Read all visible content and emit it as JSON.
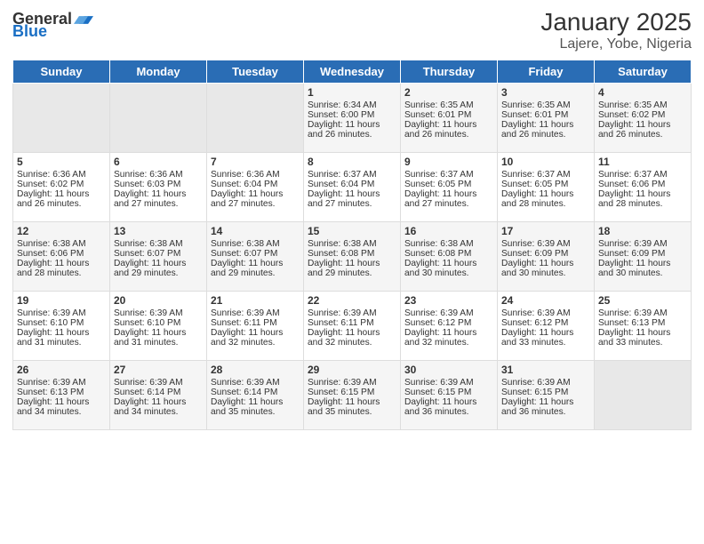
{
  "header": {
    "logo_general": "General",
    "logo_blue": "Blue",
    "title": "January 2025",
    "subtitle": "Lajere, Yobe, Nigeria"
  },
  "weekdays": [
    "Sunday",
    "Monday",
    "Tuesday",
    "Wednesday",
    "Thursday",
    "Friday",
    "Saturday"
  ],
  "weeks": [
    [
      {
        "day": "",
        "empty": true
      },
      {
        "day": "",
        "empty": true
      },
      {
        "day": "",
        "empty": true
      },
      {
        "day": "1",
        "sunrise": "6:34 AM",
        "sunset": "6:00 PM",
        "daylight": "11 hours and 26 minutes."
      },
      {
        "day": "2",
        "sunrise": "6:35 AM",
        "sunset": "6:01 PM",
        "daylight": "11 hours and 26 minutes."
      },
      {
        "day": "3",
        "sunrise": "6:35 AM",
        "sunset": "6:01 PM",
        "daylight": "11 hours and 26 minutes."
      },
      {
        "day": "4",
        "sunrise": "6:35 AM",
        "sunset": "6:02 PM",
        "daylight": "11 hours and 26 minutes."
      }
    ],
    [
      {
        "day": "5",
        "sunrise": "6:36 AM",
        "sunset": "6:02 PM",
        "daylight": "11 hours and 26 minutes."
      },
      {
        "day": "6",
        "sunrise": "6:36 AM",
        "sunset": "6:03 PM",
        "daylight": "11 hours and 27 minutes."
      },
      {
        "day": "7",
        "sunrise": "6:36 AM",
        "sunset": "6:04 PM",
        "daylight": "11 hours and 27 minutes."
      },
      {
        "day": "8",
        "sunrise": "6:37 AM",
        "sunset": "6:04 PM",
        "daylight": "11 hours and 27 minutes."
      },
      {
        "day": "9",
        "sunrise": "6:37 AM",
        "sunset": "6:05 PM",
        "daylight": "11 hours and 27 minutes."
      },
      {
        "day": "10",
        "sunrise": "6:37 AM",
        "sunset": "6:05 PM",
        "daylight": "11 hours and 28 minutes."
      },
      {
        "day": "11",
        "sunrise": "6:37 AM",
        "sunset": "6:06 PM",
        "daylight": "11 hours and 28 minutes."
      }
    ],
    [
      {
        "day": "12",
        "sunrise": "6:38 AM",
        "sunset": "6:06 PM",
        "daylight": "11 hours and 28 minutes."
      },
      {
        "day": "13",
        "sunrise": "6:38 AM",
        "sunset": "6:07 PM",
        "daylight": "11 hours and 29 minutes."
      },
      {
        "day": "14",
        "sunrise": "6:38 AM",
        "sunset": "6:07 PM",
        "daylight": "11 hours and 29 minutes."
      },
      {
        "day": "15",
        "sunrise": "6:38 AM",
        "sunset": "6:08 PM",
        "daylight": "11 hours and 29 minutes."
      },
      {
        "day": "16",
        "sunrise": "6:38 AM",
        "sunset": "6:08 PM",
        "daylight": "11 hours and 30 minutes."
      },
      {
        "day": "17",
        "sunrise": "6:39 AM",
        "sunset": "6:09 PM",
        "daylight": "11 hours and 30 minutes."
      },
      {
        "day": "18",
        "sunrise": "6:39 AM",
        "sunset": "6:09 PM",
        "daylight": "11 hours and 30 minutes."
      }
    ],
    [
      {
        "day": "19",
        "sunrise": "6:39 AM",
        "sunset": "6:10 PM",
        "daylight": "11 hours and 31 minutes."
      },
      {
        "day": "20",
        "sunrise": "6:39 AM",
        "sunset": "6:10 PM",
        "daylight": "11 hours and 31 minutes."
      },
      {
        "day": "21",
        "sunrise": "6:39 AM",
        "sunset": "6:11 PM",
        "daylight": "11 hours and 32 minutes."
      },
      {
        "day": "22",
        "sunrise": "6:39 AM",
        "sunset": "6:11 PM",
        "daylight": "11 hours and 32 minutes."
      },
      {
        "day": "23",
        "sunrise": "6:39 AM",
        "sunset": "6:12 PM",
        "daylight": "11 hours and 32 minutes."
      },
      {
        "day": "24",
        "sunrise": "6:39 AM",
        "sunset": "6:12 PM",
        "daylight": "11 hours and 33 minutes."
      },
      {
        "day": "25",
        "sunrise": "6:39 AM",
        "sunset": "6:13 PM",
        "daylight": "11 hours and 33 minutes."
      }
    ],
    [
      {
        "day": "26",
        "sunrise": "6:39 AM",
        "sunset": "6:13 PM",
        "daylight": "11 hours and 34 minutes."
      },
      {
        "day": "27",
        "sunrise": "6:39 AM",
        "sunset": "6:14 PM",
        "daylight": "11 hours and 34 minutes."
      },
      {
        "day": "28",
        "sunrise": "6:39 AM",
        "sunset": "6:14 PM",
        "daylight": "11 hours and 35 minutes."
      },
      {
        "day": "29",
        "sunrise": "6:39 AM",
        "sunset": "6:15 PM",
        "daylight": "11 hours and 35 minutes."
      },
      {
        "day": "30",
        "sunrise": "6:39 AM",
        "sunset": "6:15 PM",
        "daylight": "11 hours and 36 minutes."
      },
      {
        "day": "31",
        "sunrise": "6:39 AM",
        "sunset": "6:15 PM",
        "daylight": "11 hours and 36 minutes."
      },
      {
        "day": "",
        "empty": true
      }
    ]
  ],
  "labels": {
    "sunrise": "Sunrise:",
    "sunset": "Sunset:",
    "daylight": "Daylight:"
  }
}
